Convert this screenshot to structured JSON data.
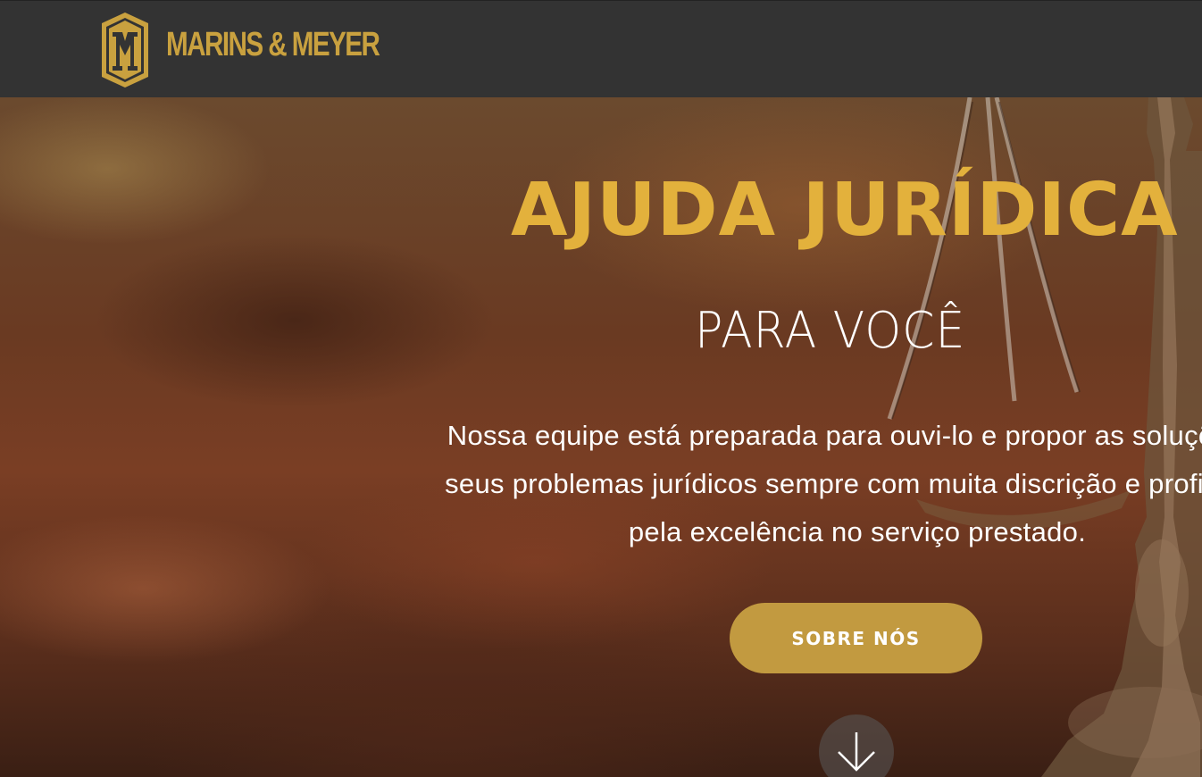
{
  "header": {
    "brand_name": "MARINS & MEYER",
    "logo_icon": "my-monogram-shield-icon",
    "background_color": "#333333",
    "brand_color": "#c9a13f"
  },
  "hero": {
    "title": "AJUDA JURÍDICA",
    "subtitle": "PARA VOCÊ",
    "description_lines": [
      "Nossa equipe está preparada para ouvi-lo e propor as soluções a",
      "seus problemas jurídicos sempre com muita discrição e profission",
      "pela excelência no serviço prestado."
    ],
    "cta_label": "SOBRE NÓS",
    "scroll_icon": "arrow-down-icon",
    "background_image": "scales-of-justice-blurred-courtroom",
    "title_color": "#e3b13c",
    "button_color": "#c29a40"
  }
}
